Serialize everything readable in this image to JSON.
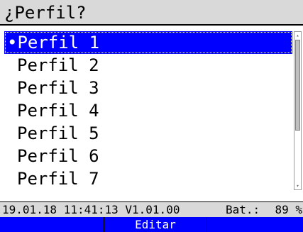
{
  "header": {
    "title": "¿Perfil?"
  },
  "profiles": {
    "items": [
      {
        "label": "•Perfil 1",
        "selected": true
      },
      {
        "label": "Perfil 2"
      },
      {
        "label": "Perfil 3"
      },
      {
        "label": "Perfil 4"
      },
      {
        "label": "Perfil 5"
      },
      {
        "label": "Perfil 6"
      },
      {
        "label": "Perfil 7"
      }
    ]
  },
  "scrollbar": {
    "up_icon": "arrow-up-icon",
    "down_icon": "arrow-down-icon",
    "up_glyph": "▴",
    "down_glyph": "▾"
  },
  "status": {
    "datetime_version": "19.01.18 11:41:13 V1.01.00",
    "battery_label": "Bat.:",
    "battery_value": "89 %"
  },
  "softkeys": {
    "left": "",
    "center": "Editar",
    "right": ""
  },
  "colors": {
    "selection": "#0000ff",
    "header_bg": "#d9d9d9",
    "softkey_bg": "#0000ff"
  }
}
